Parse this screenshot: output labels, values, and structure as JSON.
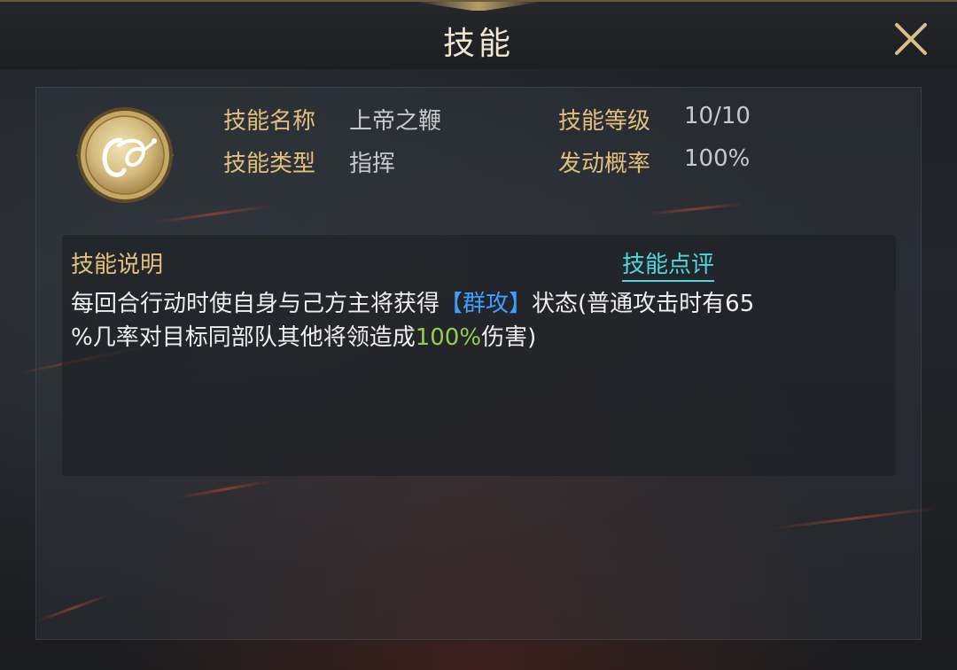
{
  "header": {
    "title": "技能"
  },
  "skill": {
    "icon": "whip-icon",
    "name_label": "技能名称",
    "name_value": "上帝之鞭",
    "level_label": "技能等级",
    "level_value": "10/10",
    "type_label": "技能类型",
    "type_value": "指挥",
    "chance_label": "发动概率",
    "chance_value": "100%"
  },
  "description": {
    "title": "技能说明",
    "review_link": "技能点评",
    "part1": "每回合行动时使自身与己方主将获得",
    "keyword": "【群攻】",
    "part2": "状态(普通攻击时有65",
    "part3": "%几率对目标同部队其他将领造成",
    "highlight": "100%",
    "part4": "伤害)"
  },
  "colors": {
    "gold_label": "#e2c07c",
    "link_cyan": "#4fd6de",
    "keyword_blue": "#3aa0ff",
    "highlight_green": "#8fd14a"
  }
}
